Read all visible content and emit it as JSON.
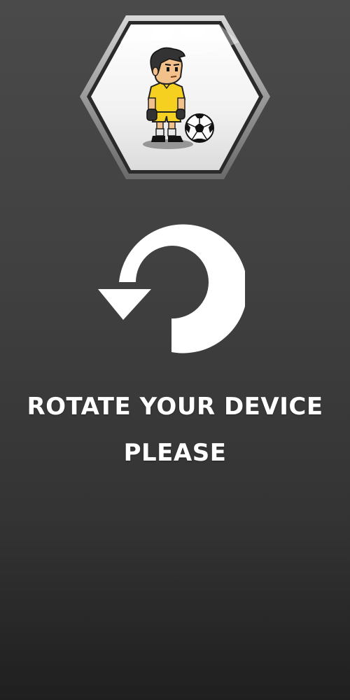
{
  "game": {
    "logo_icon": "soccer-player-hexagon-icon",
    "rotate_icon": "rotate-counterclockwise-arrow-icon",
    "message_line1": "ROTATE YOUR DEVICE",
    "message_line2": "PLEASE"
  },
  "colors": {
    "background_top": "#4a4a4a",
    "background_bottom": "#1f1f1f",
    "text": "#ffffff",
    "jersey": "#f5d020",
    "hexagon_border": "#2a2a2a"
  }
}
